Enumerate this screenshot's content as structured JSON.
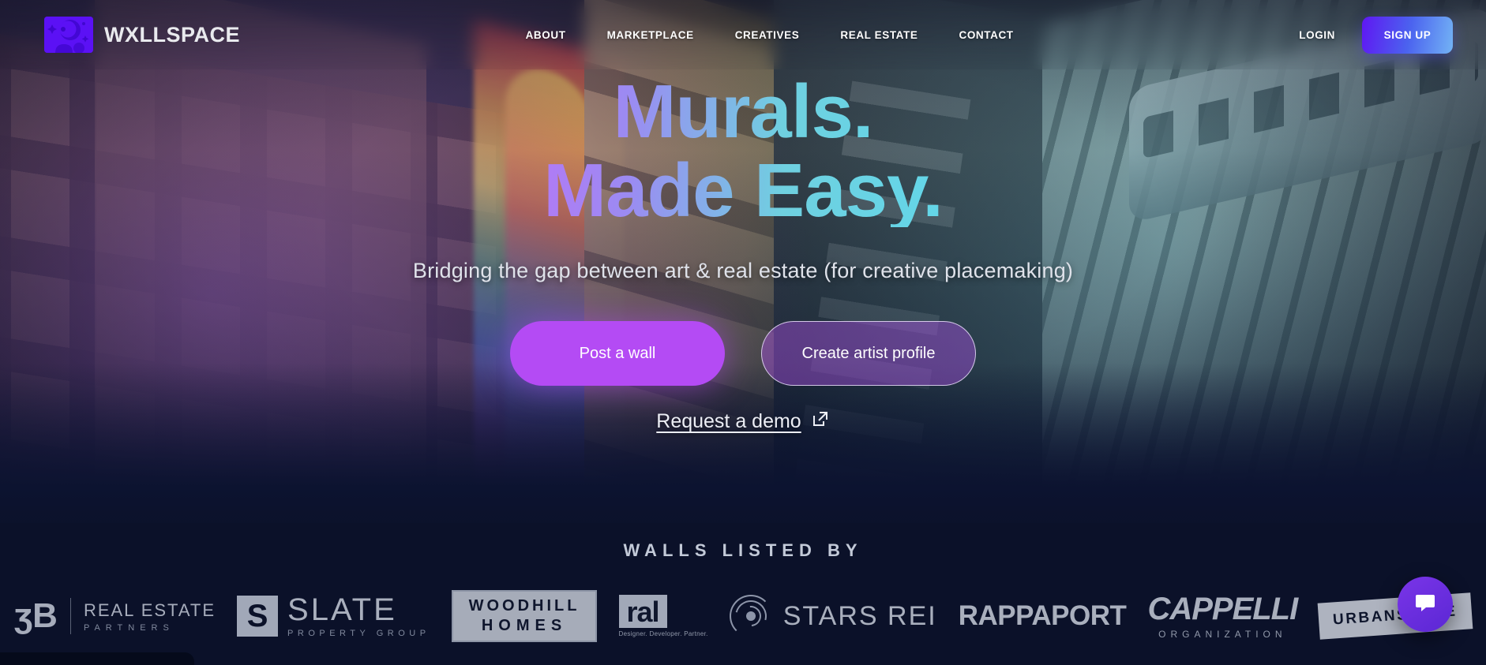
{
  "brand": {
    "name": "WXLLSPACE",
    "logo_icon": "astronaut-logo-icon",
    "logo_bg": "#5b11f5"
  },
  "nav": {
    "links": [
      {
        "label": "ABOUT"
      },
      {
        "label": "MARKETPLACE"
      },
      {
        "label": "CREATIVES"
      },
      {
        "label": "REAL ESTATE"
      },
      {
        "label": "CONTACT"
      }
    ],
    "login_label": "LOGIN",
    "signup_label": "SIGN UP",
    "signup_gradient_from": "#5f17f2",
    "signup_gradient_to": "#73b3f5"
  },
  "hero": {
    "headline_line1": "Murals.",
    "headline_line2": "Made Easy.",
    "headline_gradient_from": "#b07bf5",
    "headline_gradient_to": "#63d6e8",
    "subtitle": "Bridging the gap between art & real estate (for creative placemaking)",
    "primary_cta": "Post a wall",
    "primary_cta_color": "#b44bf4",
    "secondary_cta": "Create artist profile",
    "demo_link": "Request a demo",
    "demo_link_icon": "external-link-icon"
  },
  "partners": {
    "title": "WALLS LISTED BY",
    "logos": [
      {
        "name": "sb-real-estate-partners",
        "mark": "ʒB",
        "line1": "REAL ESTATE",
        "line2": "PARTNERS"
      },
      {
        "name": "slate-property-group",
        "mark": "S",
        "line1": "SLATE",
        "line2": "PROPERTY GROUP"
      },
      {
        "name": "woodhill-homes",
        "line1": "WOODHILL",
        "line2": "HOMES"
      },
      {
        "name": "ral",
        "mark": "ral",
        "line2": "Designer. Developer. Partner."
      },
      {
        "name": "stars-rei",
        "line1": "STARS REI"
      },
      {
        "name": "rappaport",
        "line1": "RAPPAPORT"
      },
      {
        "name": "cappelli-organization",
        "line1": "CAPPELLI",
        "line2": "ORGANIZATION"
      },
      {
        "name": "urbanspace",
        "line1": "URBANSPACE"
      }
    ]
  },
  "chat": {
    "icon": "chat-bubble-icon",
    "color": "#6b2ee0"
  }
}
